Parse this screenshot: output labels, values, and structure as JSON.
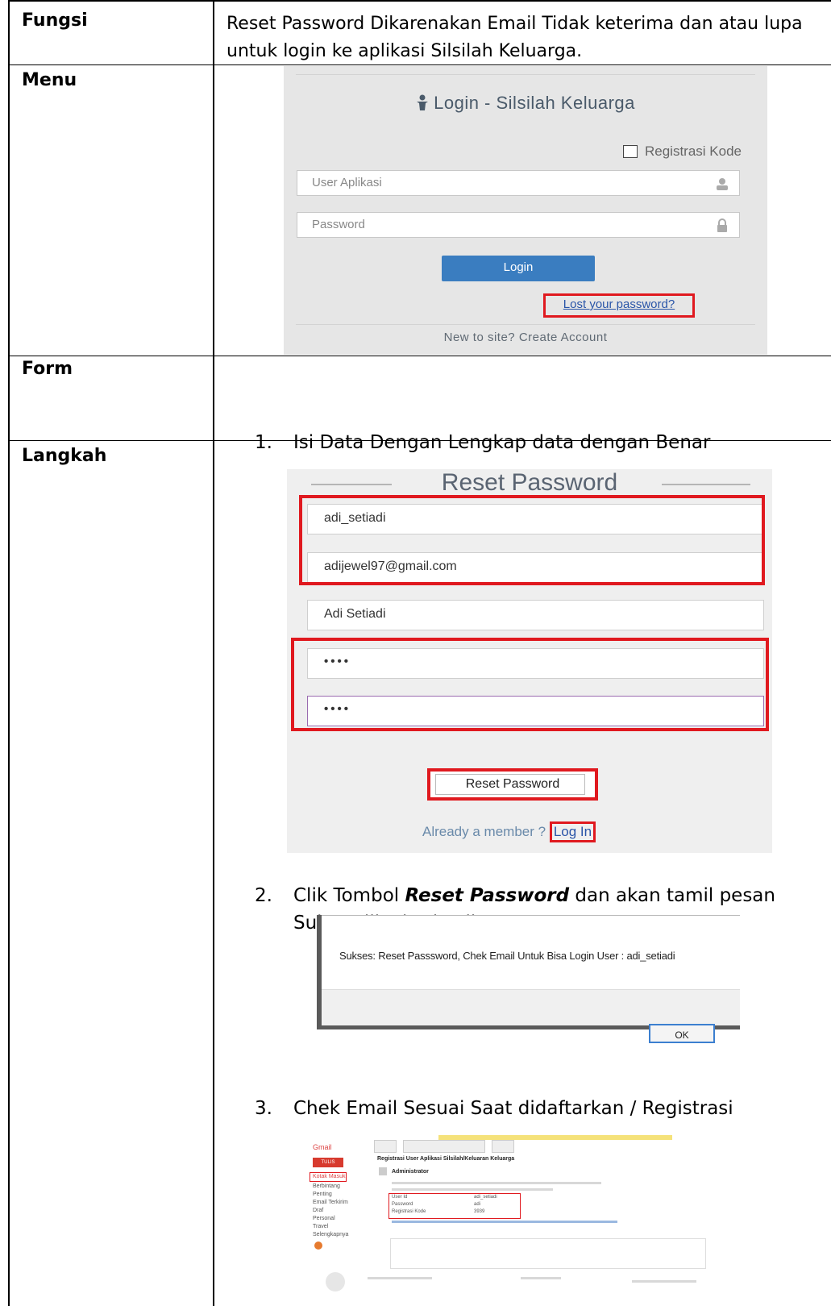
{
  "table": {
    "rows": [
      {
        "label": "Fungsi",
        "content": "Reset Password Dikarenakan Email Tidak keterima dan atau lupa untuk login ke aplikasi Silsilah Keluarga."
      },
      {
        "label": "Menu"
      },
      {
        "label": "Form"
      },
      {
        "label": "Langkah"
      }
    ]
  },
  "login": {
    "title": "Login - Silsilah Keluarga",
    "registrasi_label": "Registrasi Kode",
    "user_placeholder": "User Aplikasi",
    "password_placeholder": "Password",
    "login_button": "Login",
    "lost_password": "Lost your password?",
    "new_to_site": "New to site? Create Account"
  },
  "steps": [
    {
      "num": "1.",
      "text": "Isi Data Dengan Lengkap  data dengan Benar"
    },
    {
      "num": "2.",
      "text_before": "Clik Tombol ",
      "text_bold": "Reset Password",
      "text_after": " dan akan tamil pesan",
      "text_line2": "Sukses jika berhasil."
    },
    {
      "num": "3.",
      "text": "Chek Email Sesuai Saat didaftarkan / Registrasi"
    }
  ],
  "reset": {
    "title": "Reset Password",
    "username": "adi_setiadi",
    "email": "adijewel97@gmail.com",
    "fullname": "Adi Setiadi",
    "password_mask": "••••",
    "confirm_mask": "••••",
    "button": "Reset Password",
    "already_member": "Already a member ?",
    "login_link": "Log In"
  },
  "dialog": {
    "message": "Sukses: Reset Passsword, Chek Email Untuk Bisa Login User : adi_setiadi",
    "ok": "OK"
  },
  "gmail": {
    "app_label": "Gmail",
    "compose": "TULIS",
    "subject": "Registrasi User Aplikasi Silsilah/Keluaran Keluarga",
    "sender": "Administrator",
    "fields": [
      {
        "key": "User Id",
        "value": "adi_setiadi"
      },
      {
        "key": "Password",
        "value": "adi"
      },
      {
        "key": "Registrasi Kode",
        "value": "3939"
      }
    ],
    "sidebar": [
      "Kotak Masuk",
      "Berbintang",
      "Penting",
      "Email Terkirim",
      "Draf",
      "Personal",
      "Travel",
      "Selengkapnya"
    ]
  },
  "colors": {
    "highlight_red": "#e0191f",
    "login_button_blue": "#3a7dc0",
    "login_panel_bg": "#e6e6e6"
  }
}
